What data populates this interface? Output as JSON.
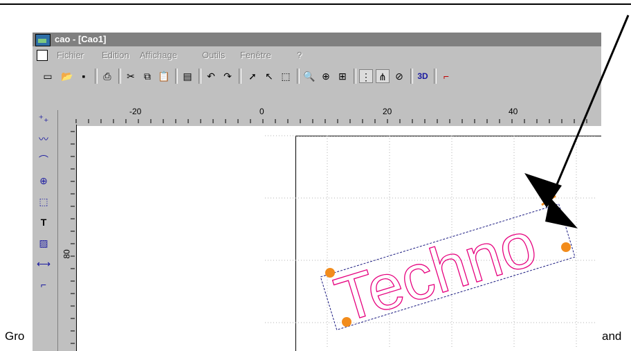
{
  "caption": {
    "left": "Gro",
    "right": "and"
  },
  "window": {
    "title": "cao - [Cao1]",
    "menu": [
      "Fichier",
      "Edition",
      "Affichage",
      "Outils",
      "Fenêtre",
      "?"
    ],
    "toolbar_3d": "3D",
    "ruler_h": [
      "-20",
      "0",
      "20",
      "40"
    ],
    "ruler_v": [
      "80"
    ],
    "drawing_text": "Techno"
  },
  "colors": {
    "handle": "#f28c1c",
    "text_outline": "#e6007e",
    "bbox": "#1a1a80",
    "title_bg": "#808080"
  }
}
